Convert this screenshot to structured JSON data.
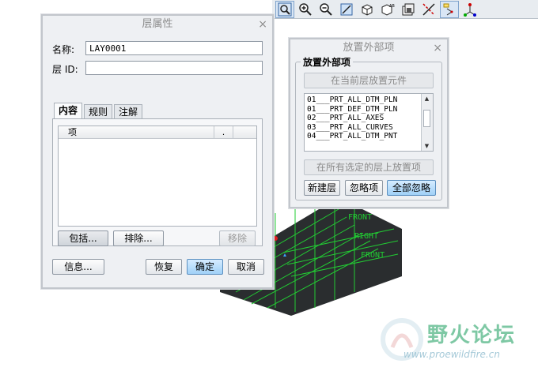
{
  "layer_props": {
    "title": "层属性",
    "close": "×",
    "name_label": "名称:",
    "name_value": "LAY0001",
    "layer_id_label": "层 ID:",
    "layer_id_value": "",
    "tabs": [
      {
        "label": "内容"
      },
      {
        "label": "规则"
      },
      {
        "label": "注解"
      }
    ],
    "list_header_item": "项",
    "list_header_col2": ".",
    "include_button": "包括...",
    "exclude_button": "排除...",
    "remove_button": "移除",
    "info_button": "信息...",
    "reset_button": "恢复",
    "ok_button": "确定",
    "cancel_button": "取消"
  },
  "place_external": {
    "title": "放置外部项",
    "close": "×",
    "group_label": "放置外部项",
    "place_current_button": "在当前层放置元件",
    "items": [
      "01___PRT_ALL_DTM_PLN",
      "01___PRT_DEF_DTM_PLN",
      "02___PRT_ALL_AXES",
      "03___PRT_ALL_CURVES",
      "04___PRT_ALL_DTM_PNT"
    ],
    "place_all_selected_button": "在所有选定的层上放置项",
    "new_layer_button": "新建层",
    "ignore_button": "忽略项",
    "ignore_all_button": "全部忽略"
  },
  "model_labels": {
    "l1": "FRONT",
    "l2": "RIGHT"
  },
  "watermark": {
    "title": "野火论坛",
    "url": "www.proewildfire.cn"
  },
  "colors": {
    "model_green": "#22cc33",
    "model_dark": "#2a2d2f",
    "accent_blue": "#9fd0f7"
  }
}
